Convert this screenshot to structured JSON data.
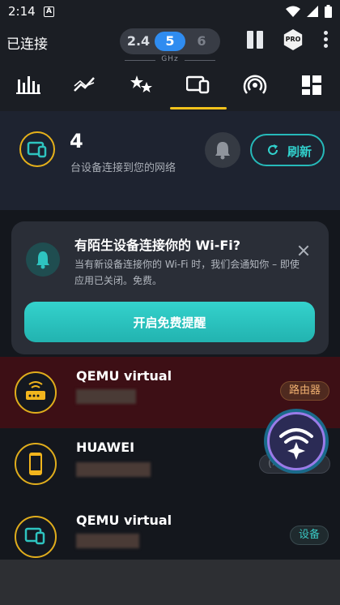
{
  "status_bar": {
    "time": "2:14",
    "notification_icon": "A"
  },
  "header": {
    "connection_status": "已连接",
    "bands": [
      "2.4",
      "5",
      "6"
    ],
    "selected_band": "5",
    "band_unit": "GHz",
    "pro_label": "PRO"
  },
  "tabs": [
    {
      "name": "signal-bars-icon"
    },
    {
      "name": "speed-chart-icon"
    },
    {
      "name": "stars-icon"
    },
    {
      "name": "devices-icon",
      "active": true
    },
    {
      "name": "radar-icon"
    },
    {
      "name": "grid-icon"
    }
  ],
  "summary": {
    "device_count": "4",
    "device_count_label": "台设备连接到您的网络",
    "refresh_label": "刷新"
  },
  "alert_card": {
    "title": "有陌生设备连接你的 Wi-Fi?",
    "body": "当有新设备连接你的 Wi-Fi 时，我们会通知你 – 即使应用已关闭。免费。",
    "enable_button": "开启免费提醒"
  },
  "devices": [
    {
      "name": "QEMU virtual",
      "badge": "路由器",
      "type": "router"
    },
    {
      "name": "HUAWEI",
      "badge": "(本设备)",
      "type": "phone"
    },
    {
      "name": "QEMU virtual",
      "badge": "设备",
      "type": "device"
    }
  ],
  "colors": {
    "accent_teal": "#2ec4c0",
    "accent_gold": "#e6b11a",
    "band_selected": "#2f8cf0",
    "router_row_bg": "#3d0f15"
  }
}
